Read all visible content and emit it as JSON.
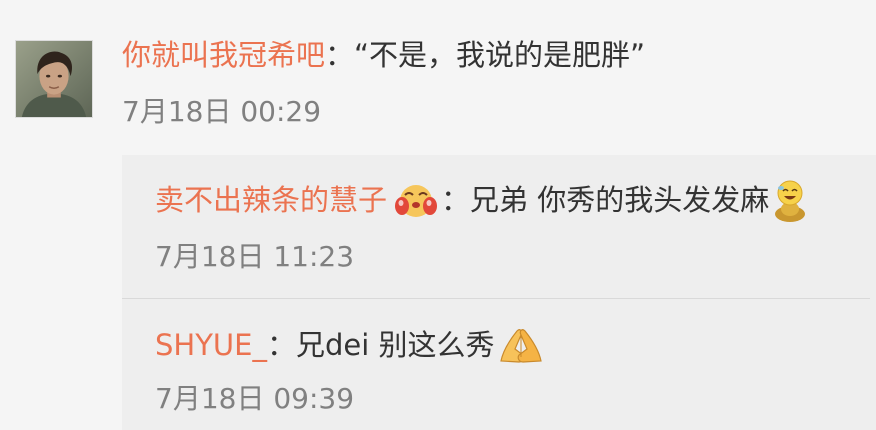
{
  "comment": {
    "avatar_icon": "user-avatar-photo",
    "username": "你就叫我冠希吧",
    "text": "：“不是，我说的是肥胖”",
    "timestamp": "7月18日 00:29"
  },
  "replies": [
    {
      "username": "卖不出辣条的慧子",
      "name_emoji": "blushing-hug-face-icon",
      "text": "：兄弟 你秀的我头发发麻",
      "trailing_emoji": "yellow-face-figure-icon",
      "timestamp": "7月18日 11:23"
    },
    {
      "username": "SHYUE_",
      "text": "：兄dei 别这么秀",
      "trailing_emoji": "praying-hands-icon",
      "timestamp": "7月18日 09:39"
    }
  ],
  "colors": {
    "background": "#f5f5f5",
    "reply_background": "#eeeeee",
    "username": "#eb7350",
    "text": "#333333",
    "timestamp": "#808080",
    "divider": "#d9d9d9"
  }
}
